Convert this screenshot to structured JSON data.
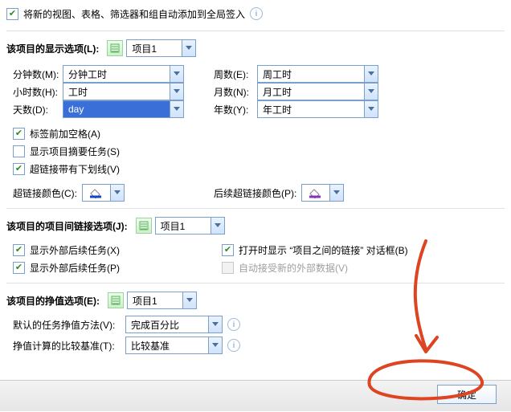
{
  "top": {
    "auto_add_label": "将新的视图、表格、筛选器和组自动添加到全局签入"
  },
  "display_options": {
    "section_label": "该项目的显示选项(L):",
    "project_name": "项目1",
    "minutes_label": "分钟数(M):",
    "minutes_value": "分钟工时",
    "hours_label": "小时数(H):",
    "hours_value": "工时",
    "days_label": "天数(D):",
    "days_value": "day",
    "weeks_label": "周数(E):",
    "weeks_value": "周工时",
    "months_label": "月数(N):",
    "months_value": "月工时",
    "years_label": "年数(Y):",
    "years_value": "年工时",
    "space_before_label": "标签前加空格(A)",
    "show_summary_tasks": "显示项目摘要任务(S)",
    "underline_hyperlinks": "超链接带有下划线(V)",
    "hyperlink_color_label": "超链接颜色(C):",
    "followed_hyperlink_color_label": "后续超链接颜色(P):"
  },
  "crossproject": {
    "section_label": "该项目的项目间链接选项(J):",
    "project_name": "项目1",
    "show_external_successors": "显示外部后续任务(X)",
    "show_external_predecessors": "显示外部后续任务(P)",
    "show_links_dialog": "打开时显示 “项目之间的链接” 对话框(B)",
    "auto_accept_new": "自动接受新的外部数据(V)"
  },
  "earned_value": {
    "section_label": "该项目的挣值选项(E):",
    "project_name": "项目1",
    "default_method_label": "默认的任务挣值方法(V):",
    "default_method_value": "完成百分比",
    "baseline_label": "挣值计算的比较基准(T):",
    "baseline_value": "比较基准"
  },
  "buttons": {
    "ok": "确定"
  }
}
